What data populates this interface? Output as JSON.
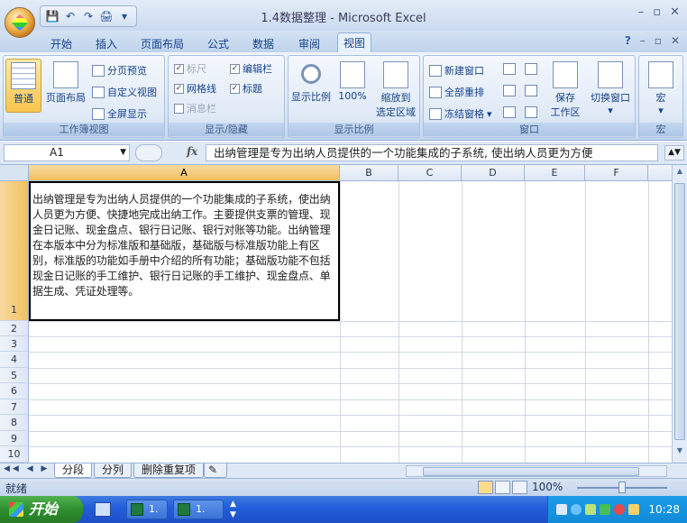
{
  "window": {
    "title": "1.4数据整理 - Microsoft Excel",
    "min": "–",
    "restore": "▫",
    "close": "✕"
  },
  "qat": {
    "save": "💾",
    "undo": "↶",
    "redo": "↷",
    "print": "🖨",
    "more": "▾"
  },
  "tabs": [
    {
      "label": "开始"
    },
    {
      "label": "插入"
    },
    {
      "label": "页面布局"
    },
    {
      "label": "公式"
    },
    {
      "label": "数据"
    },
    {
      "label": "审阅"
    },
    {
      "label": "视图"
    }
  ],
  "ribbon_right": {
    "help": "?",
    "min": "–",
    "restore": "▫",
    "close": "✕"
  },
  "groups": {
    "workbook_views": {
      "label": "工作簿视图",
      "normal": "普通",
      "page_layout": "页面布局",
      "page_break": "分页预览",
      "custom": "自定义视图",
      "fullscreen": "全屏显示"
    },
    "show_hide": {
      "label": "显示/隐藏",
      "ruler": "标尺",
      "gridlines": "网格线",
      "message_bar": "消息栏",
      "formula_bar": "编辑栏",
      "headings": "标题"
    },
    "zoom": {
      "label": "显示比例",
      "zoom": "显示比例",
      "hundred": "100%",
      "zoom_sel_line1": "缩放到",
      "zoom_sel_line2": "选定区域"
    },
    "window": {
      "label": "窗口",
      "new_window": "新建窗口",
      "arrange_all": "全部重排",
      "freeze": "冻结窗格",
      "save_ws_line1": "保存",
      "save_ws_line2": "工作区",
      "switch": "切换窗口"
    },
    "macro": {
      "label": "宏",
      "macro": "宏"
    }
  },
  "formula_bar": {
    "name_box": "A1",
    "fx": "fx",
    "content": "出纳管理是专为出纳人员提供的一个功能集成的子系统, 使出纳人员更为方便"
  },
  "columns": [
    "A",
    "B",
    "C",
    "D",
    "E",
    "F"
  ],
  "rows": [
    "1",
    "2",
    "3",
    "4",
    "5",
    "6",
    "7",
    "8",
    "9",
    "10"
  ],
  "cell_a1": "出纳管理是专为出纳人员提供的一个功能集成的子系统，使出纳人员更为方便、快捷地完成出纳工作。主要提供支票的管理、现金日记账、现金盘点、银行日记账、银行对账等功能。出纳管理在本版本中分为标准版和基础版，基础版与标准版功能上有区别，标准版的功能如手册中介绍的所有功能；基础版功能不包括现金日记账的手工维护、银行日记账的手工维护、现金盘点、单据生成、凭证处理等。",
  "sheets": [
    {
      "label": "分段"
    },
    {
      "label": "分列"
    },
    {
      "label": "删除重复项"
    }
  ],
  "status": {
    "text": "就绪",
    "zoom": "100%"
  },
  "taskbar": {
    "start": "开始",
    "task1": "1.",
    "task2": "1.",
    "clock": "10:28"
  }
}
